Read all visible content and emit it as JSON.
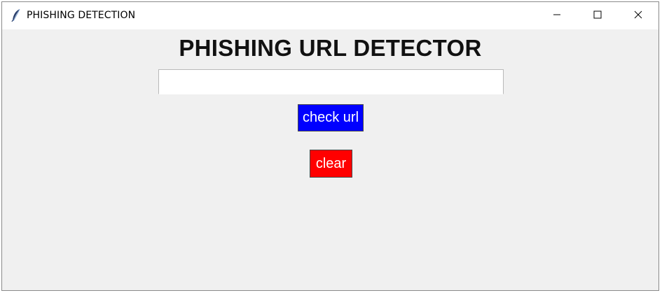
{
  "window": {
    "title": "PHISHING DETECTION",
    "icon": "feather-icon",
    "controls": [
      "minimize-icon",
      "maximize-icon",
      "close-icon"
    ]
  },
  "main": {
    "heading": "PHISHING URL DETECTOR",
    "url_input": {
      "value": "",
      "placeholder": ""
    },
    "check_button": {
      "label": "check url",
      "color": "#0000ff"
    },
    "clear_button": {
      "label": "clear",
      "color": "#ff0000"
    }
  },
  "colors": {
    "window_background": "#f0f0f0",
    "titlebar_background": "#ffffff",
    "button_text": "#ffffff"
  }
}
